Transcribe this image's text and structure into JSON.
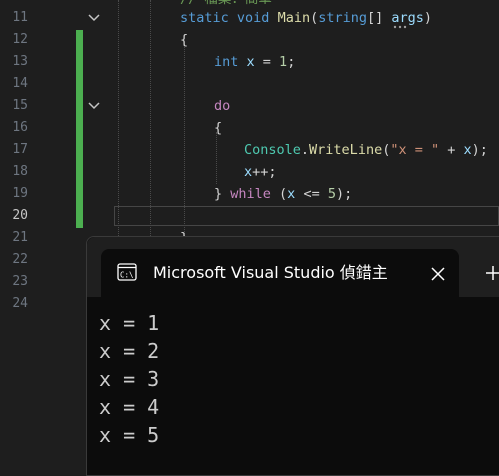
{
  "editor": {
    "top_comment": "// 檔案：簡單",
    "line_numbers": [
      "11",
      "12",
      "13",
      "14",
      "15",
      "16",
      "17",
      "18",
      "19",
      "20",
      "21",
      "22",
      "23",
      "24"
    ],
    "current_line": "20",
    "code": {
      "l11": {
        "kw_static": "static",
        "kw_void": "void",
        "fn_main": "Main",
        "params_open": "(",
        "type_string": "string",
        "brackets": "[] ",
        "var_args": "args",
        "params_close": ")"
      },
      "l12": {
        "brace": "{"
      },
      "l13": {
        "kw_int": "int",
        "var_x": " x",
        "op": " = ",
        "num": "1",
        "semi": ";"
      },
      "l15": {
        "kw_do": "do"
      },
      "l16": {
        "brace": "{"
      },
      "l17": {
        "type_console": "Console",
        "dot": ".",
        "fn_writeline": "WriteLine",
        "open": "(",
        "str": "\"x = \"",
        "plus": " + ",
        "var_x": "x",
        "close": ");"
      },
      "l18": {
        "var_x": "x",
        "op": "++;"
      },
      "l19": {
        "brace": "} ",
        "kw_while": "while",
        "open": " (",
        "var_x": "x",
        "op": " <= ",
        "num": "5",
        "close": ");"
      },
      "l21": {
        "brace": "}"
      }
    }
  },
  "terminal": {
    "tab_title": "Microsoft Visual Studio 偵錯主",
    "tab_icon": "terminal-icon",
    "close_icon": "close-icon",
    "new_tab_icon": "plus-icon",
    "output_lines": [
      "x = 1",
      "x = 2",
      "x = 3",
      "x = 4",
      "x = 5"
    ]
  },
  "colors": {
    "editor_bg": "#1e1e1e",
    "change_bar": "#4caf50",
    "terminal_bg": "#0c0c0c",
    "keyword": "#569cd6",
    "control_keyword": "#c586c0",
    "type": "#4ec9b0",
    "function": "#dcdcaa",
    "variable": "#9cdcfe",
    "string": "#ce9178",
    "number": "#b5cea8"
  }
}
